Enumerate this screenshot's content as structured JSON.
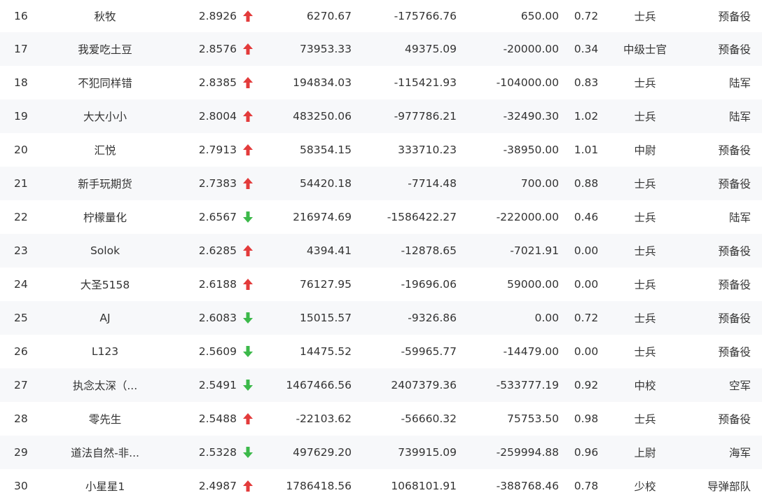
{
  "colors": {
    "up": "#e33b3b",
    "down": "#3cb94a",
    "text": "#333333",
    "row_alt": "#f7f8fa"
  },
  "rows": [
    {
      "rank": "16",
      "name": "秋牧",
      "score": "2.8926",
      "trend": "up",
      "trend_icon": "arrow-up-icon",
      "v1": "6270.67",
      "v2": "-175766.76",
      "v3": "650.00",
      "ratio": "0.72",
      "military_rank": "士兵",
      "unit": "预备役"
    },
    {
      "rank": "17",
      "name": "我爱吃土豆",
      "score": "2.8576",
      "trend": "up",
      "trend_icon": "arrow-up-icon",
      "v1": "73953.33",
      "v2": "49375.09",
      "v3": "-20000.00",
      "ratio": "0.34",
      "military_rank": "中级士官",
      "unit": "预备役"
    },
    {
      "rank": "18",
      "name": "不犯同样错",
      "score": "2.8385",
      "trend": "up",
      "trend_icon": "arrow-up-icon",
      "v1": "194834.03",
      "v2": "-115421.93",
      "v3": "-104000.00",
      "ratio": "0.83",
      "military_rank": "士兵",
      "unit": "陆军"
    },
    {
      "rank": "19",
      "name": "大大小小",
      "score": "2.8004",
      "trend": "up",
      "trend_icon": "arrow-up-icon",
      "v1": "483250.06",
      "v2": "-977786.21",
      "v3": "-32490.30",
      "ratio": "1.02",
      "military_rank": "士兵",
      "unit": "陆军"
    },
    {
      "rank": "20",
      "name": "汇悦",
      "score": "2.7913",
      "trend": "up",
      "trend_icon": "arrow-up-icon",
      "v1": "58354.15",
      "v2": "333710.23",
      "v3": "-38950.00",
      "ratio": "1.01",
      "military_rank": "中尉",
      "unit": "预备役"
    },
    {
      "rank": "21",
      "name": "新手玩期货",
      "score": "2.7383",
      "trend": "up",
      "trend_icon": "arrow-up-icon",
      "v1": "54420.18",
      "v2": "-7714.48",
      "v3": "700.00",
      "ratio": "0.88",
      "military_rank": "士兵",
      "unit": "预备役"
    },
    {
      "rank": "22",
      "name": "柠檬量化",
      "score": "2.6567",
      "trend": "down",
      "trend_icon": "arrow-down-icon",
      "v1": "216974.69",
      "v2": "-1586422.27",
      "v3": "-222000.00",
      "ratio": "0.46",
      "military_rank": "士兵",
      "unit": "陆军"
    },
    {
      "rank": "23",
      "name": "Solok",
      "score": "2.6285",
      "trend": "up",
      "trend_icon": "arrow-up-icon",
      "v1": "4394.41",
      "v2": "-12878.65",
      "v3": "-7021.91",
      "ratio": "0.00",
      "military_rank": "士兵",
      "unit": "预备役"
    },
    {
      "rank": "24",
      "name": "大圣5158",
      "score": "2.6188",
      "trend": "up",
      "trend_icon": "arrow-up-icon",
      "v1": "76127.95",
      "v2": "-19696.06",
      "v3": "59000.00",
      "ratio": "0.00",
      "military_rank": "士兵",
      "unit": "预备役"
    },
    {
      "rank": "25",
      "name": "AJ",
      "score": "2.6083",
      "trend": "down",
      "trend_icon": "arrow-down-icon",
      "v1": "15015.57",
      "v2": "-9326.86",
      "v3": "0.00",
      "ratio": "0.72",
      "military_rank": "士兵",
      "unit": "预备役"
    },
    {
      "rank": "26",
      "name": "L123",
      "score": "2.5609",
      "trend": "down",
      "trend_icon": "arrow-down-icon",
      "v1": "14475.52",
      "v2": "-59965.77",
      "v3": "-14479.00",
      "ratio": "0.00",
      "military_rank": "士兵",
      "unit": "预备役"
    },
    {
      "rank": "27",
      "name": "执念太深（...",
      "score": "2.5491",
      "trend": "down",
      "trend_icon": "arrow-down-icon",
      "v1": "1467466.56",
      "v2": "2407379.36",
      "v3": "-533777.19",
      "ratio": "0.92",
      "military_rank": "中校",
      "unit": "空军"
    },
    {
      "rank": "28",
      "name": "零先生",
      "score": "2.5488",
      "trend": "up",
      "trend_icon": "arrow-up-icon",
      "v1": "-22103.62",
      "v2": "-56660.32",
      "v3": "75753.50",
      "ratio": "0.98",
      "military_rank": "士兵",
      "unit": "预备役"
    },
    {
      "rank": "29",
      "name": "道法自然-非...",
      "score": "2.5328",
      "trend": "down",
      "trend_icon": "arrow-down-icon",
      "v1": "497629.20",
      "v2": "739915.09",
      "v3": "-259994.88",
      "ratio": "0.96",
      "military_rank": "上尉",
      "unit": "海军"
    },
    {
      "rank": "30",
      "name": "小星星1",
      "score": "2.4987",
      "trend": "up",
      "trend_icon": "arrow-up-icon",
      "v1": "1786418.56",
      "v2": "1068101.91",
      "v3": "-388768.46",
      "ratio": "0.78",
      "military_rank": "少校",
      "unit": "导弹部队"
    }
  ]
}
